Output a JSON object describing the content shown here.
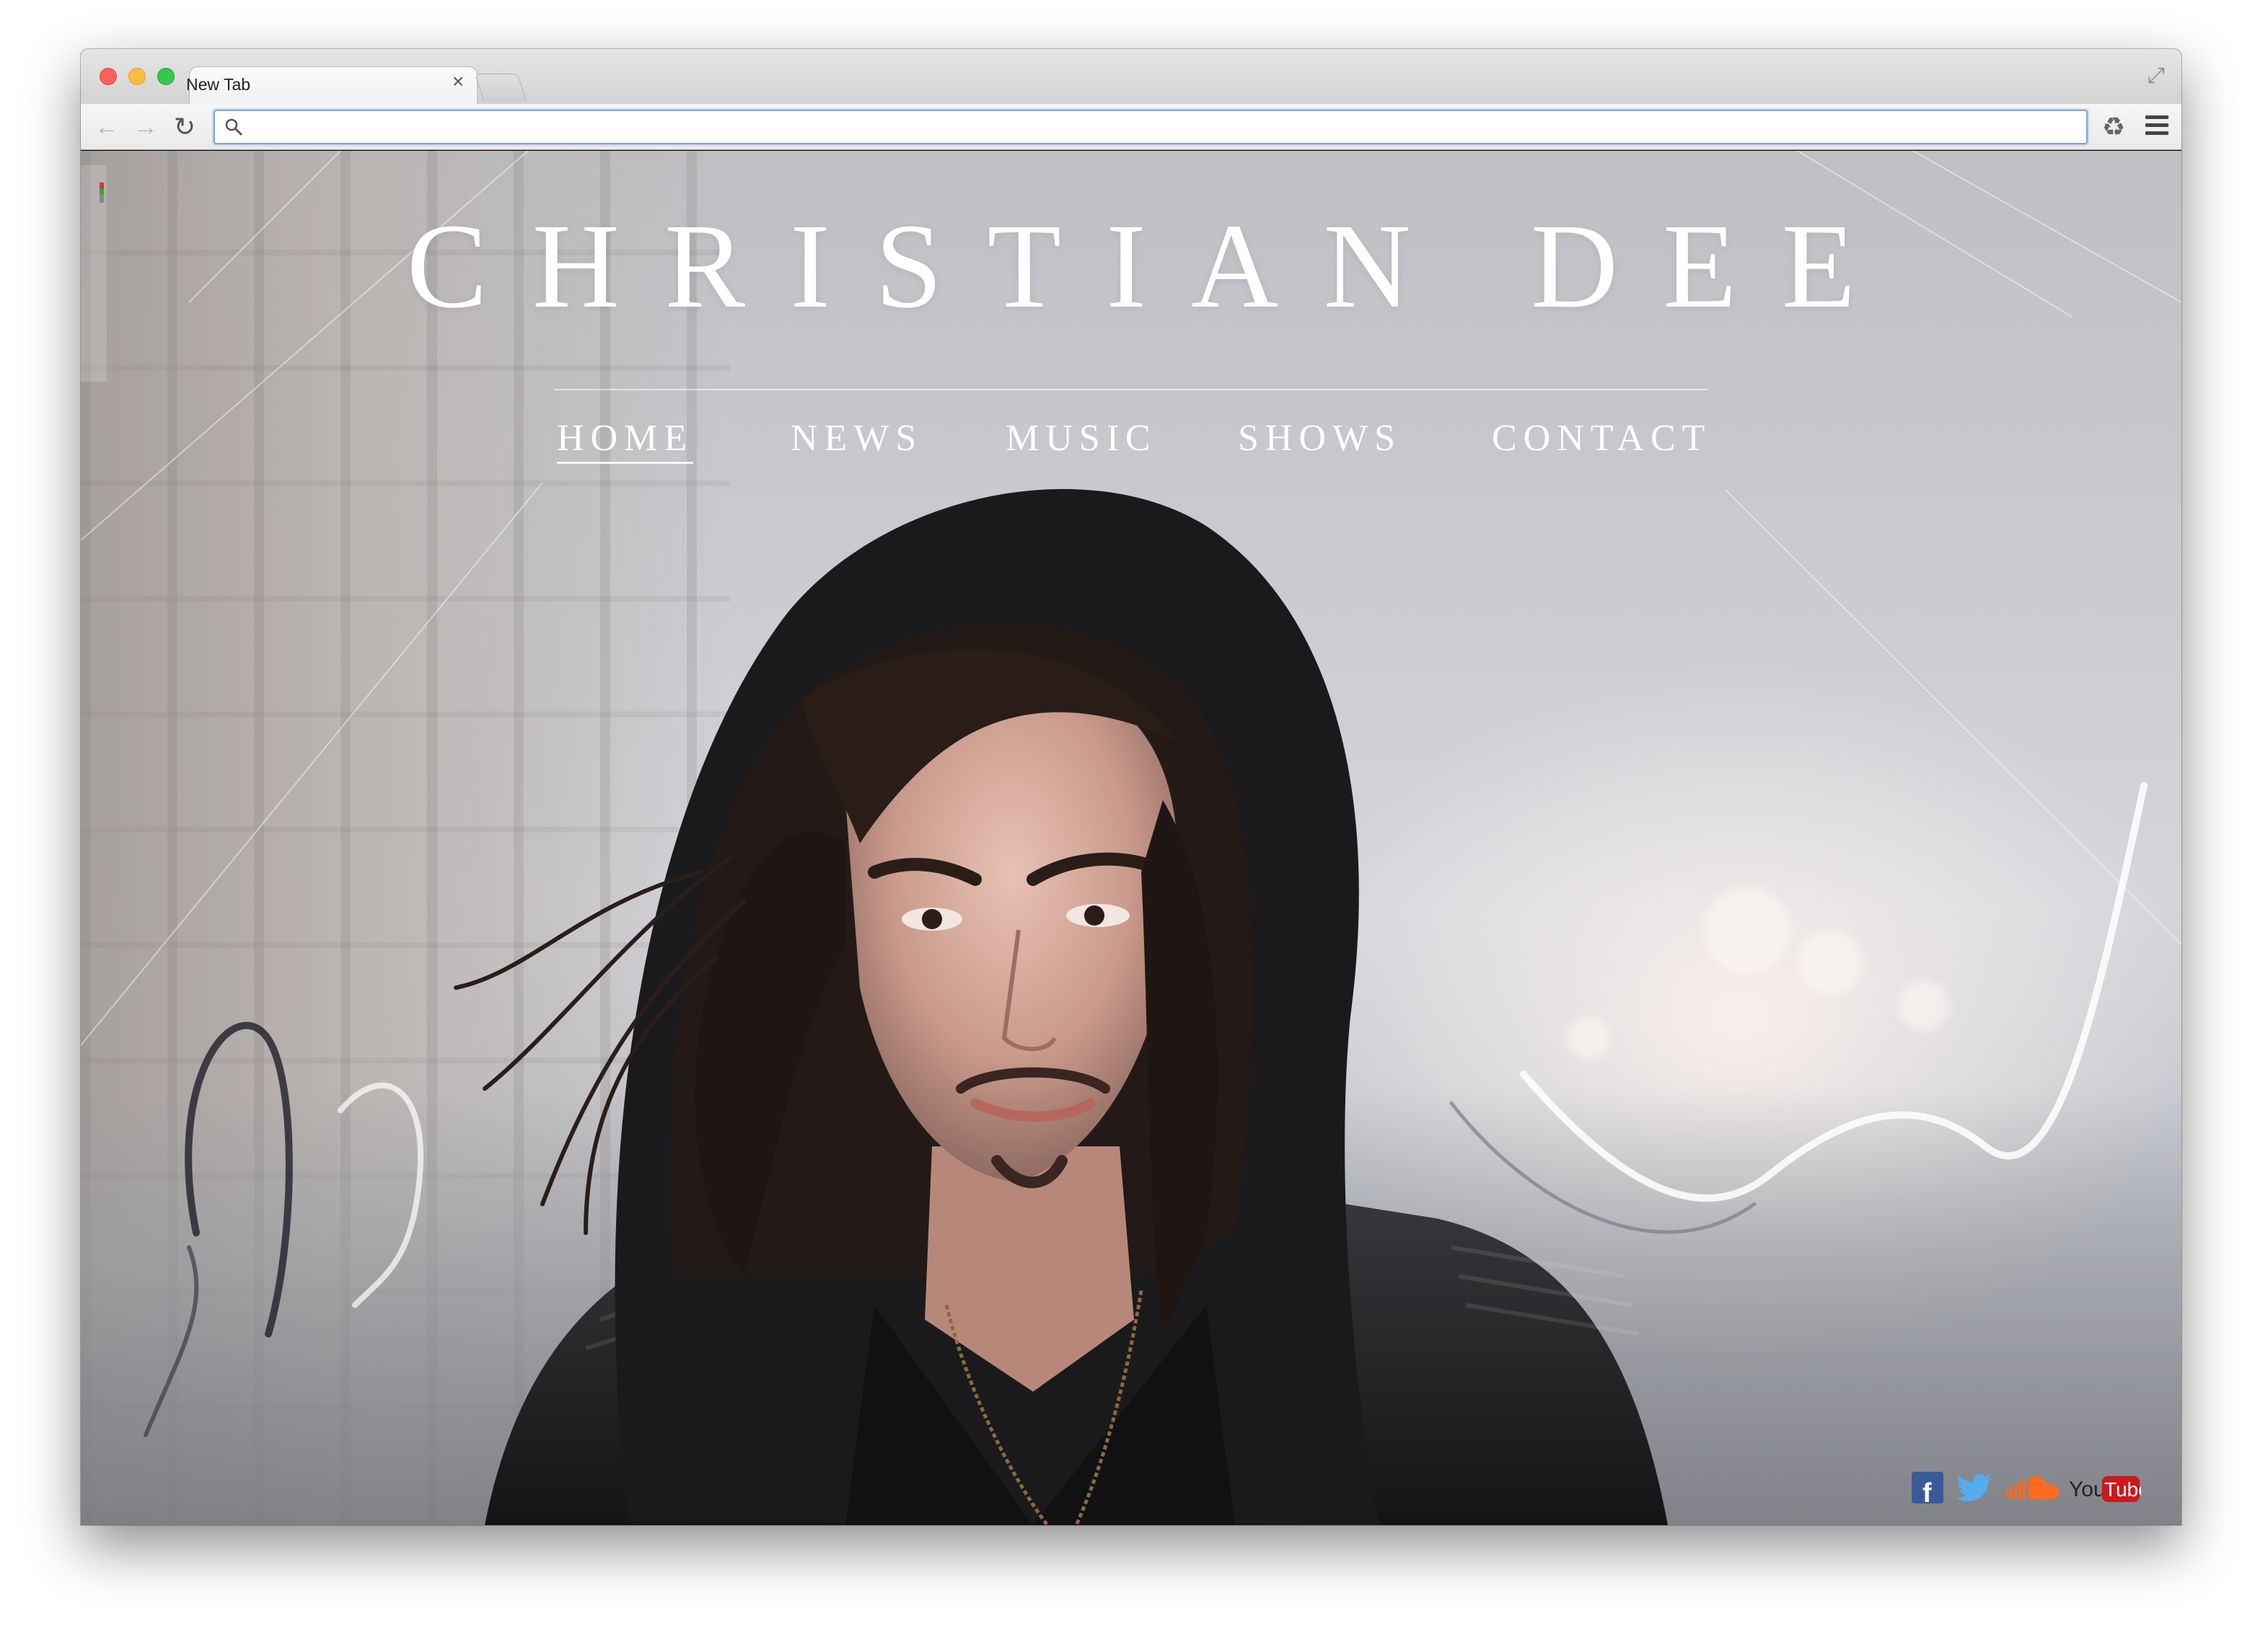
{
  "browser": {
    "tab_title": "New Tab",
    "tab_close": "×",
    "address_value": "",
    "address_placeholder": "",
    "back_glyph": "←",
    "forward_glyph": "→",
    "reload_glyph": "↻",
    "extension_glyph": "♻",
    "fullscreen_glyph": "⤢"
  },
  "site": {
    "title": "CHRISTIAN DEE",
    "nav": [
      {
        "label": "HOME",
        "active": true
      },
      {
        "label": "NEWS",
        "active": false
      },
      {
        "label": "MUSIC",
        "active": false
      },
      {
        "label": "SHOWS",
        "active": false
      },
      {
        "label": "CONTACT",
        "active": false
      }
    ],
    "social": [
      {
        "name": "facebook",
        "label": "f",
        "color": "#3b5998"
      },
      {
        "name": "twitter",
        "label": "",
        "color": "#55acee"
      },
      {
        "name": "soundcloud",
        "label": "",
        "color": "#ff6a1f"
      },
      {
        "name": "youtube",
        "label_you": "You",
        "label_tube": "Tube",
        "color": "#cc181e"
      }
    ]
  },
  "colors": {
    "accent_focus": "#7aa6dd",
    "title_text": "#ffffff"
  }
}
